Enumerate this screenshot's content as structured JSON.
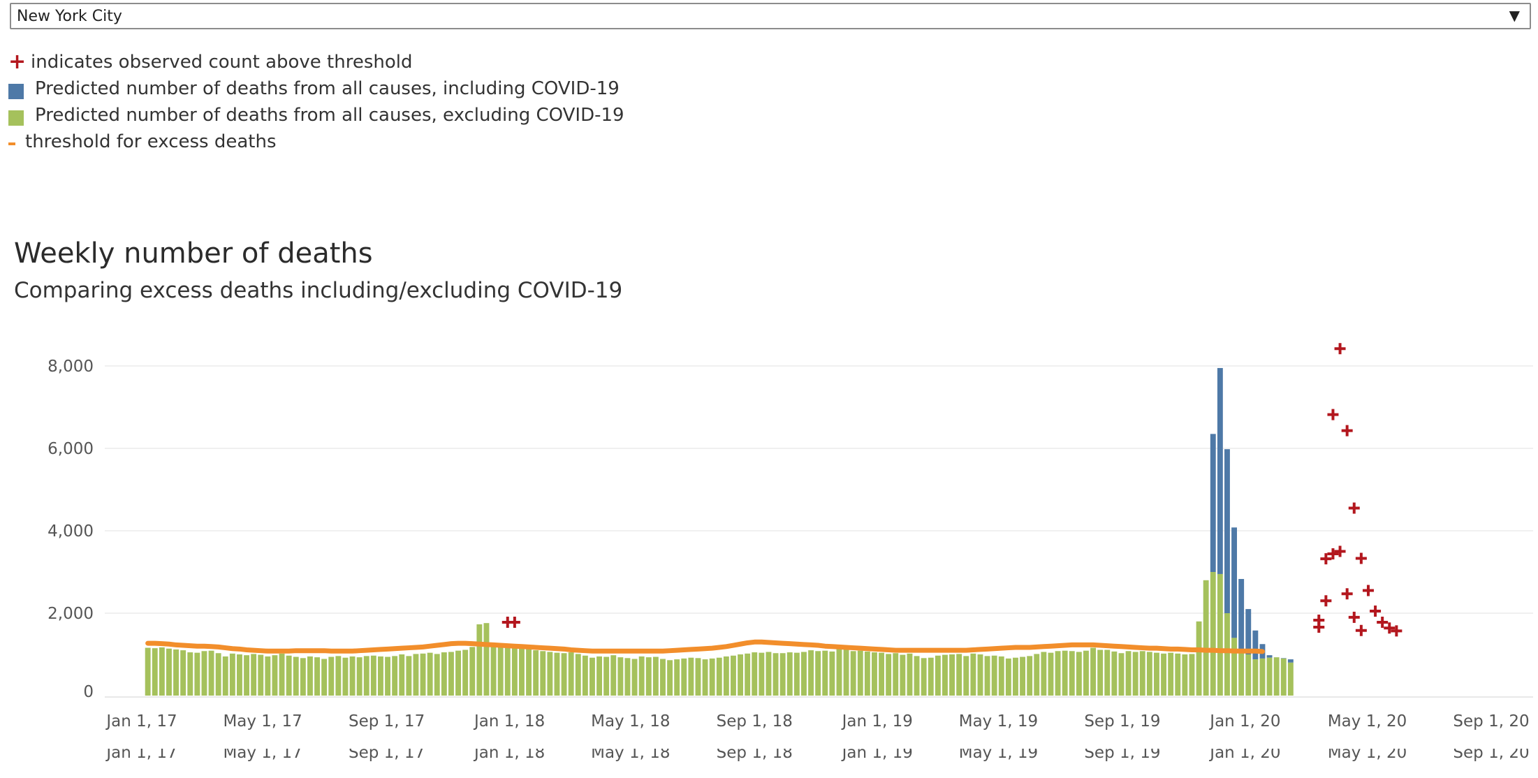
{
  "filter": {
    "selected": "New York City"
  },
  "legend": {
    "items": [
      {
        "label": "indicates observed count above threshold",
        "color": "#b3171e",
        "icon": "plus-icon"
      },
      {
        "label": "Predicted number of deaths from all causes, including COVID-19",
        "color": "#4e79a7",
        "icon": "square-swatch"
      },
      {
        "label": "Predicted number of deaths from all causes, excluding COVID-19",
        "color": "#a5c15c",
        "icon": "square-swatch"
      },
      {
        "label": "threshold for excess deaths",
        "color": "#f28e2b",
        "icon": "dash-line"
      }
    ]
  },
  "chart_data": {
    "type": "bar",
    "title": "Weekly number of deaths",
    "subtitle": "Comparing excess deaths including/excluding COVID-19",
    "ylim": [
      0,
      8000
    ],
    "y_ticks": [
      0,
      2000,
      4000,
      6000,
      8000
    ],
    "y_tick_labels": [
      "0",
      "2,000",
      "4,000",
      "6,000",
      "8,000"
    ],
    "x_start": "2017-01-07",
    "x_ticks": [
      {
        "date": "2017-01-01",
        "label": "Jan 1, 17"
      },
      {
        "date": "2017-05-01",
        "label": "May 1, 17"
      },
      {
        "date": "2017-09-01",
        "label": "Sep 1, 17"
      },
      {
        "date": "2018-01-01",
        "label": "Jan 1, 18"
      },
      {
        "date": "2018-05-01",
        "label": "May 1, 18"
      },
      {
        "date": "2018-09-01",
        "label": "Sep 1, 18"
      },
      {
        "date": "2019-01-01",
        "label": "Jan 1, 19"
      },
      {
        "date": "2019-05-01",
        "label": "May 1, 19"
      },
      {
        "date": "2019-09-01",
        "label": "Sep 1, 19"
      },
      {
        "date": "2020-01-01",
        "label": "Jan 1, 20"
      },
      {
        "date": "2020-05-01",
        "label": "May 1, 20"
      },
      {
        "date": "2020-09-01",
        "label": "Sep 1, 20"
      }
    ],
    "grid": true,
    "colors": {
      "including": "#4e79a7",
      "excluding": "#a5c15c",
      "threshold": "#f28e2b",
      "marker": "#b3171e"
    },
    "series": [
      {
        "name": "Predicted number of deaths from all causes, excluding COVID-19",
        "values": [
          1160,
          1150,
          1170,
          1140,
          1120,
          1100,
          1050,
          1040,
          1080,
          1090,
          1030,
          950,
          1020,
          1000,
          980,
          1010,
          990,
          950,
          980,
          1020,
          970,
          940,
          910,
          950,
          930,
          890,
          940,
          960,
          920,
          950,
          930,
          960,
          970,
          950,
          940,
          960,
          1000,
          960,
          1010,
          1020,
          1040,
          1010,
          1050,
          1060,
          1090,
          1110,
          1180,
          1730,
          1760,
          1250,
          1230,
          1220,
          1180,
          1170,
          1150,
          1100,
          1080,
          1060,
          1040,
          1030,
          1050,
          1010,
          970,
          920,
          950,
          940,
          980,
          930,
          910,
          890,
          950,
          930,
          940,
          890,
          860,
          880,
          900,
          920,
          910,
          880,
          900,
          920,
          950,
          970,
          1000,
          1020,
          1050,
          1040,
          1060,
          1030,
          1030,
          1050,
          1040,
          1060,
          1100,
          1080,
          1090,
          1070,
          1130,
          1140,
          1080,
          1090,
          1070,
          1050,
          1040,
          1010,
          1030,
          990,
          1020,
          960,
          910,
          920,
          970,
          990,
          1000,
          1010,
          960,
          1020,
          1000,
          960,
          970,
          950,
          900,
          920,
          940,
          960,
          1010,
          1060,
          1040,
          1080,
          1090,
          1080,
          1060,
          1090,
          1160,
          1110,
          1110,
          1070,
          1030,
          1080,
          1060,
          1080,
          1060,
          1040,
          1020,
          1040,
          1020,
          1000,
          1010,
          1800,
          2800,
          3000,
          2950,
          2000,
          1400,
          1100,
          1000,
          880,
          900,
          920,
          930,
          900,
          800
        ],
        "color": "#a5c15c"
      },
      {
        "name": "Predicted number of deaths from all causes, including COVID-19",
        "values": [
          1160,
          1150,
          1170,
          1140,
          1120,
          1100,
          1050,
          1040,
          1080,
          1090,
          1030,
          950,
          1020,
          1000,
          980,
          1010,
          990,
          950,
          980,
          1020,
          970,
          940,
          910,
          950,
          930,
          890,
          940,
          960,
          920,
          950,
          930,
          960,
          970,
          950,
          940,
          960,
          1000,
          960,
          1010,
          1020,
          1040,
          1010,
          1050,
          1060,
          1090,
          1110,
          1180,
          1730,
          1760,
          1250,
          1230,
          1220,
          1180,
          1170,
          1150,
          1100,
          1080,
          1060,
          1040,
          1030,
          1050,
          1010,
          970,
          920,
          950,
          940,
          980,
          930,
          910,
          890,
          950,
          930,
          940,
          890,
          860,
          880,
          900,
          920,
          910,
          880,
          900,
          920,
          950,
          970,
          1000,
          1020,
          1050,
          1040,
          1060,
          1030,
          1030,
          1050,
          1040,
          1060,
          1100,
          1080,
          1090,
          1070,
          1130,
          1140,
          1080,
          1090,
          1070,
          1050,
          1040,
          1010,
          1030,
          990,
          1020,
          960,
          910,
          920,
          970,
          990,
          1000,
          1010,
          960,
          1020,
          1000,
          960,
          970,
          950,
          900,
          920,
          940,
          960,
          1010,
          1060,
          1040,
          1080,
          1090,
          1080,
          1060,
          1090,
          1160,
          1110,
          1110,
          1070,
          1030,
          1080,
          1060,
          1080,
          1060,
          1040,
          1020,
          1040,
          1020,
          1000,
          1010,
          1400,
          2800,
          6350,
          7950,
          5980,
          4080,
          2830,
          2100,
          1580,
          1250,
          980,
          920,
          910,
          880
        ],
        "color": "#4e79a7"
      },
      {
        "name": "threshold for excess deaths",
        "values": [
          1270,
          1270,
          1260,
          1250,
          1230,
          1220,
          1210,
          1200,
          1200,
          1190,
          1180,
          1160,
          1140,
          1130,
          1110,
          1100,
          1090,
          1080,
          1080,
          1080,
          1080,
          1090,
          1090,
          1090,
          1090,
          1090,
          1080,
          1080,
          1080,
          1080,
          1090,
          1100,
          1110,
          1120,
          1130,
          1140,
          1150,
          1160,
          1170,
          1180,
          1200,
          1220,
          1240,
          1260,
          1270,
          1270,
          1260,
          1250,
          1240,
          1230,
          1220,
          1210,
          1200,
          1190,
          1180,
          1170,
          1160,
          1150,
          1140,
          1130,
          1110,
          1100,
          1090,
          1080,
          1080,
          1080,
          1080,
          1080,
          1080,
          1080,
          1080,
          1080,
          1080,
          1080,
          1090,
          1100,
          1110,
          1120,
          1130,
          1140,
          1150,
          1170,
          1190,
          1220,
          1250,
          1280,
          1300,
          1300,
          1290,
          1280,
          1270,
          1260,
          1250,
          1240,
          1230,
          1220,
          1200,
          1190,
          1180,
          1170,
          1160,
          1150,
          1140,
          1130,
          1120,
          1110,
          1100,
          1100,
          1100,
          1100,
          1100,
          1100,
          1100,
          1100,
          1100,
          1100,
          1100,
          1110,
          1120,
          1130,
          1140,
          1150,
          1160,
          1170,
          1170,
          1170,
          1180,
          1190,
          1200,
          1210,
          1220,
          1230,
          1230,
          1230,
          1230,
          1220,
          1210,
          1200,
          1190,
          1180,
          1170,
          1160,
          1150,
          1150,
          1140,
          1130,
          1130,
          1120,
          1110,
          1110,
          1100,
          1100,
          1090,
          1090,
          1080,
          1080,
          1080,
          1080,
          1070
        ],
        "color": "#f28e2b"
      }
    ],
    "above_threshold_markers": [
      {
        "date": "2017-12-30",
        "value": 1780
      },
      {
        "date": "2018-01-06",
        "value": 1780
      },
      {
        "date": "2020-03-14",
        "value": 1830
      },
      {
        "date": "2020-03-14",
        "value": 1660
      },
      {
        "date": "2020-03-21",
        "value": 2300
      },
      {
        "date": "2020-03-21",
        "value": 3320
      },
      {
        "date": "2020-03-28",
        "value": 3440
      },
      {
        "date": "2020-03-28",
        "value": 6820
      },
      {
        "date": "2020-04-04",
        "value": 3500
      },
      {
        "date": "2020-04-04",
        "value": 8420
      },
      {
        "date": "2020-04-11",
        "value": 6430
      },
      {
        "date": "2020-04-11",
        "value": 2470
      },
      {
        "date": "2020-04-18",
        "value": 4550
      },
      {
        "date": "2020-04-18",
        "value": 1900
      },
      {
        "date": "2020-04-25",
        "value": 3330
      },
      {
        "date": "2020-04-25",
        "value": 1580
      },
      {
        "date": "2020-05-02",
        "value": 2550
      },
      {
        "date": "2020-05-09",
        "value": 2050
      },
      {
        "date": "2020-05-16",
        "value": 1780
      },
      {
        "date": "2020-05-23",
        "value": 1640
      },
      {
        "date": "2020-05-30",
        "value": 1570
      }
    ]
  }
}
